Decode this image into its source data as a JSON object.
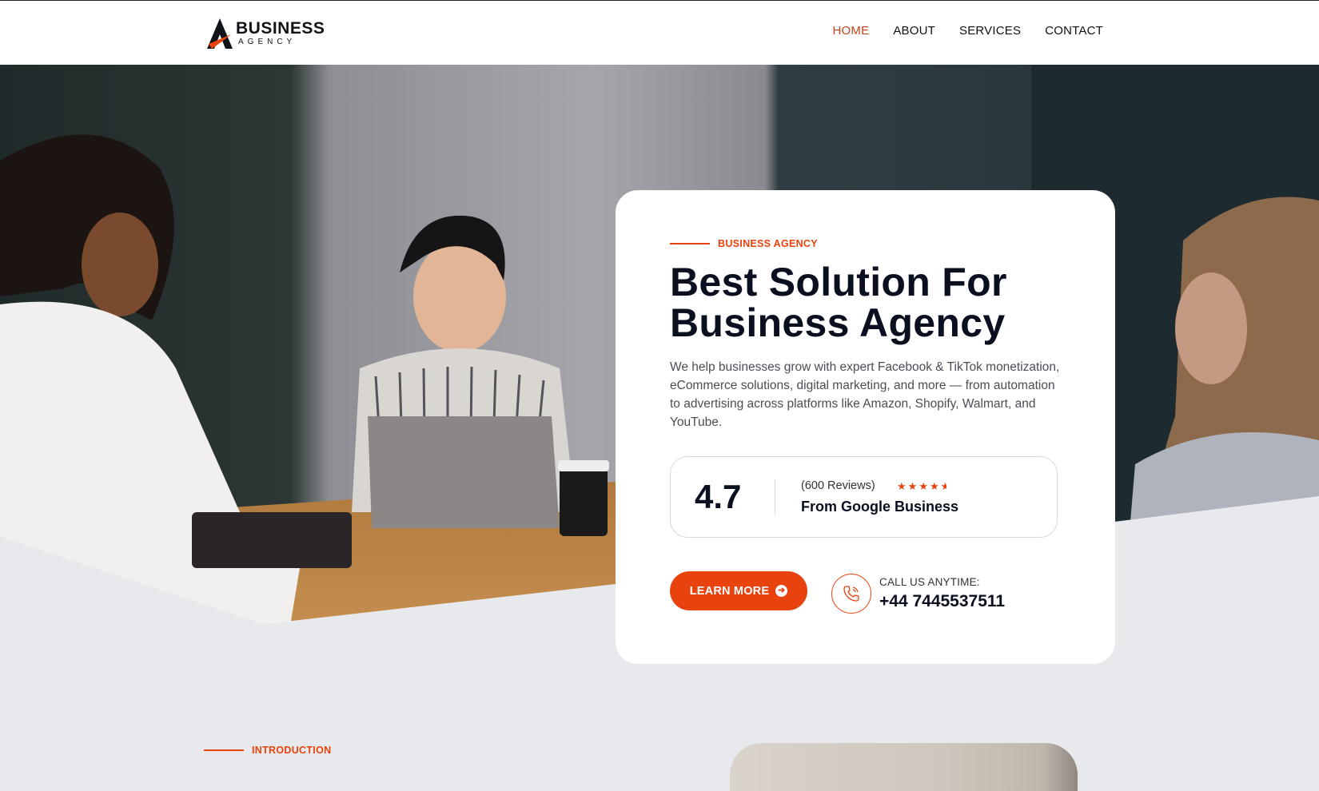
{
  "brand": {
    "name": "BUSINESS",
    "tagline": "AGENCY"
  },
  "nav": {
    "items": [
      {
        "label": "HOME",
        "active": true
      },
      {
        "label": "ABOUT",
        "active": false
      },
      {
        "label": "SERVICES",
        "active": false
      },
      {
        "label": "CONTACT",
        "active": false
      }
    ]
  },
  "hero": {
    "eyebrow": "BUSINESS AGENCY",
    "title": "Best Solution For Business Agency",
    "description": "We help businesses grow with expert Facebook & TikTok monetization, eCommerce solutions, digital marketing, and more — from automation to advertising across platforms like Amazon, Shopify, Walmart, and YouTube.",
    "rating": {
      "score": "4.7",
      "count": "(600 Reviews)",
      "stars": 4.5,
      "source": "From Google Business"
    },
    "cta_label": "LEARN MORE",
    "call": {
      "label": "CALL US ANYTIME:",
      "number": "+44 7445537511"
    }
  },
  "intro": {
    "eyebrow": "INTRODUCTION"
  },
  "colors": {
    "accent": "#e8420f",
    "dark": "#0b1020",
    "nav_active": "#c4431a",
    "section_bg": "#e8e9ec"
  },
  "icons": [
    "logo-mark-icon",
    "arrow-right-circle-icon",
    "phone-icon",
    "star-icon"
  ]
}
